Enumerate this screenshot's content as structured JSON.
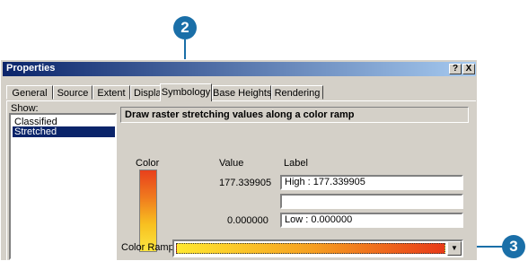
{
  "callouts": {
    "symbology": "2",
    "color_ramp": "3"
  },
  "window": {
    "title": "Properties",
    "help_button": "?",
    "close_button": "X"
  },
  "tabs": [
    "General",
    "Source",
    "Extent",
    "Display",
    "Symbology",
    "Base Heights",
    "Rendering"
  ],
  "show": {
    "label": "Show:",
    "items": [
      "Classified",
      "Stretched"
    ],
    "selected": "Stretched"
  },
  "panel": {
    "header": "Draw raster stretching values along a color ramp",
    "color_header": "Color",
    "value_header": "Value",
    "label_header": "Label",
    "high_value": "177.339905",
    "low_value": "0.000000",
    "high_label": "High : 177.339905",
    "mid_label": "",
    "low_label": "Low : 0.000000",
    "color_ramp_label": "Color Ramp:",
    "colors": {
      "ramp_top": "#e8401c",
      "ramp_bottom": "#fbe540"
    }
  }
}
